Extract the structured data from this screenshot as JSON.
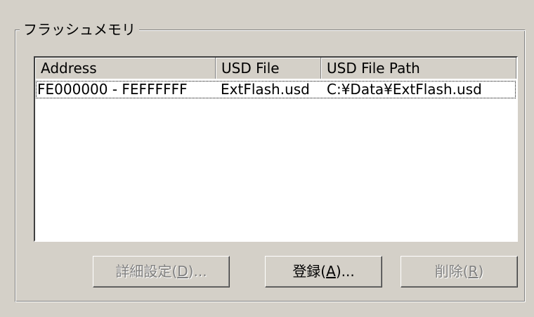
{
  "groupbox": {
    "title": "フラッシュメモリ"
  },
  "listview": {
    "columns": [
      "Address",
      "USD File",
      "USD File Path"
    ],
    "rows": [
      {
        "address": "FE000000 - FEFFFFFF",
        "usd_file": "ExtFlash.usd",
        "usd_file_path": "C:¥Data¥ExtFlash.usd"
      }
    ]
  },
  "buttons": {
    "detail": {
      "label": "詳細設定(",
      "mnemonic": "D",
      "suffix": ")...",
      "enabled": false
    },
    "register": {
      "label": "登録(",
      "mnemonic": "A",
      "suffix": ")...",
      "enabled": true
    },
    "delete": {
      "label": "削除(",
      "mnemonic": "R",
      "suffix": ")",
      "enabled": false
    }
  },
  "colors": {
    "face": "#d4d0c8",
    "shadow": "#808080",
    "highlight": "#ffffff",
    "disabled_text": "#808080"
  }
}
